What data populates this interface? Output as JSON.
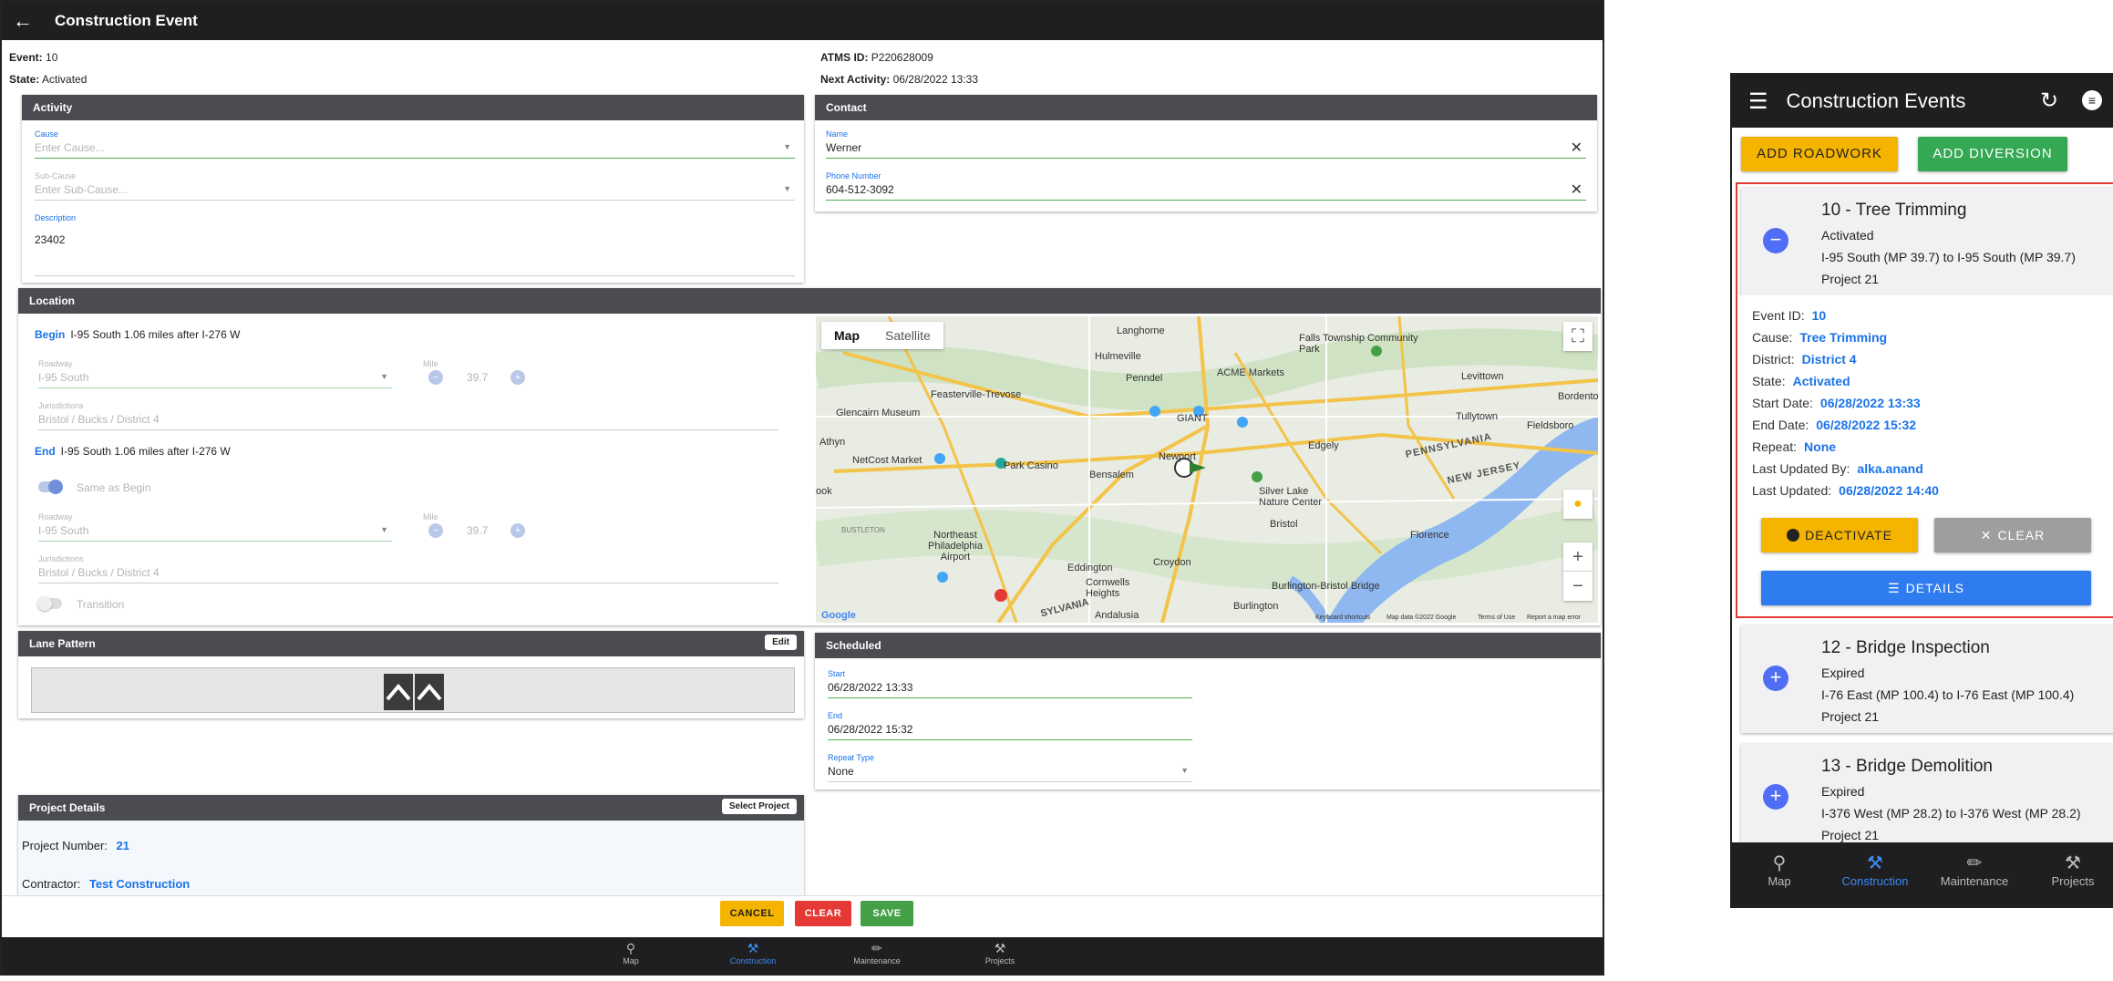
{
  "desktop": {
    "title": "Construction Event",
    "event_label": "Event:",
    "event_value": "10",
    "state_label": "State:",
    "state_value": "Activated",
    "atms_label": "ATMS ID:",
    "atms_value": "P220628009",
    "next_label": "Next Activity:",
    "next_value": "06/28/2022 13:33",
    "activity": {
      "header": "Activity",
      "cause_label": "Cause",
      "cause_placeholder": "Enter Cause...",
      "subcause_label": "Sub-Cause",
      "subcause_placeholder": "Enter Sub-Cause...",
      "description_label": "Description",
      "description_value": "23402"
    },
    "contact": {
      "header": "Contact",
      "name_label": "Name",
      "name_value": "Werner",
      "phone_label": "Phone Number",
      "phone_value": "604-512-3092"
    },
    "location": {
      "header": "Location",
      "begin_tag": "Begin",
      "begin_text": "I-95 South 1.06 miles after I-276 W",
      "roadway_label": "Roadway",
      "roadway_value": "I-95 South",
      "mile_label": "Mile",
      "mile_value": "39.7",
      "jurisdictions_label": "Jurisdictions",
      "jurisdictions_value": "Bristol / Bucks / District 4",
      "end_tag": "End",
      "end_text": "I-95 South 1.06 miles after I-276 W",
      "same_as_begin": "Same as Begin",
      "end_roadway_value": "I-95 South",
      "end_mile_value": "39.7",
      "end_jurisdictions_value": "Bristol / Bucks / District 4",
      "transition": "Transition"
    },
    "map": {
      "type_map": "Map",
      "type_satellite": "Satellite",
      "labels": [
        "Langhorne",
        "Hulmeville",
        "Falls Township Community Park",
        "Levittown",
        "Feasterville-Trevose",
        "Penndel",
        "ACME Markets",
        "Glencairn Museum",
        "GIANT",
        "Tullytown",
        "Bordento",
        "Athyn",
        "Fieldsboro",
        "NetCost Market",
        "Park Casino",
        "Bensalem",
        "Newport",
        "Edgely",
        "PENNSYLVANIA",
        "NEW JERSEY",
        "Silver Lake Nature Center",
        "Bristol",
        "ook",
        "BUSTLETON",
        "Northeast Philadelphia Airport",
        "Eddington",
        "Croydon",
        "Florence",
        "Cornwells Heights",
        "Burlington-Bristol Bridge",
        "Burlington",
        "Andalusia",
        "SYLVANIA"
      ],
      "footer": [
        "Keyboard shortcuts",
        "Map data ©2022 Google",
        "Terms of Use",
        "Report a map error"
      ],
      "logo": "Google"
    },
    "lane": {
      "header": "Lane Pattern",
      "edit_label": "Edit"
    },
    "scheduled": {
      "header": "Scheduled",
      "start_label": "Start",
      "start_value": "06/28/2022 13:33",
      "end_label": "End",
      "end_value": "06/28/2022 15:32",
      "repeat_label": "Repeat Type",
      "repeat_value": "None"
    },
    "project": {
      "header": "Project Details",
      "select_label": "Select Project",
      "number_label": "Project Number:",
      "number_value": "21",
      "contractor_label": "Contractor:",
      "contractor_value": "Test Construction"
    },
    "actions": {
      "cancel": "CANCEL",
      "clear": "CLEAR",
      "save": "SAVE"
    },
    "nav": [
      {
        "label": "Map"
      },
      {
        "label": "Construction"
      },
      {
        "label": "Maintenance"
      },
      {
        "label": "Projects"
      }
    ],
    "colors": {
      "cancel": "#f5b400",
      "clear": "#e53935",
      "save": "#43a047",
      "accent": "#1a73e8",
      "header": "#4b4b52"
    }
  },
  "mobile": {
    "title": "Construction Events",
    "add_roadwork": "ADD ROADWORK",
    "add_diversion": "ADD DIVERSION",
    "selected": {
      "title": "10 - Tree Trimming",
      "status": "Activated",
      "route": "I-95 South (MP 39.7) to I-95 South (MP 39.7)",
      "project": "Project 21",
      "details": [
        {
          "label": "Event ID:",
          "value": "10"
        },
        {
          "label": "Cause:",
          "value": "Tree Trimming"
        },
        {
          "label": "District:",
          "value": "District 4"
        },
        {
          "label": "State:",
          "value": "Activated"
        },
        {
          "label": "Start Date:",
          "value": "06/28/2022 13:33"
        },
        {
          "label": "End Date:",
          "value": "06/28/2022 15:32"
        },
        {
          "label": "Repeat:",
          "value": "None"
        },
        {
          "label": "Last Updated By:",
          "value": "alka.anand"
        },
        {
          "label": "Last Updated:",
          "value": "06/28/2022 14:40"
        }
      ],
      "deactivate": "DEACTIVATE",
      "clear": "CLEAR",
      "details_btn": "DETAILS"
    },
    "events": [
      {
        "title": "12 - Bridge Inspection",
        "status": "Expired",
        "route": "I-76 East (MP 100.4) to I-76 East (MP 100.4)",
        "project": "Project 21"
      },
      {
        "title": "13 - Bridge Demolition",
        "status": "Expired",
        "route": "I-376 West (MP 28.2) to I-376 West (MP 28.2)",
        "project": "Project 21"
      }
    ],
    "nav": [
      {
        "label": "Map"
      },
      {
        "label": "Construction"
      },
      {
        "label": "Maintenance"
      },
      {
        "label": "Projects"
      }
    ],
    "colors": {
      "add_roadwork": "#f5b400",
      "add_diversion": "#34a853",
      "deactivate": "#f5b400",
      "clear": "#9e9e9e",
      "details": "#2f7bf0",
      "highlight": "#e53935"
    }
  }
}
